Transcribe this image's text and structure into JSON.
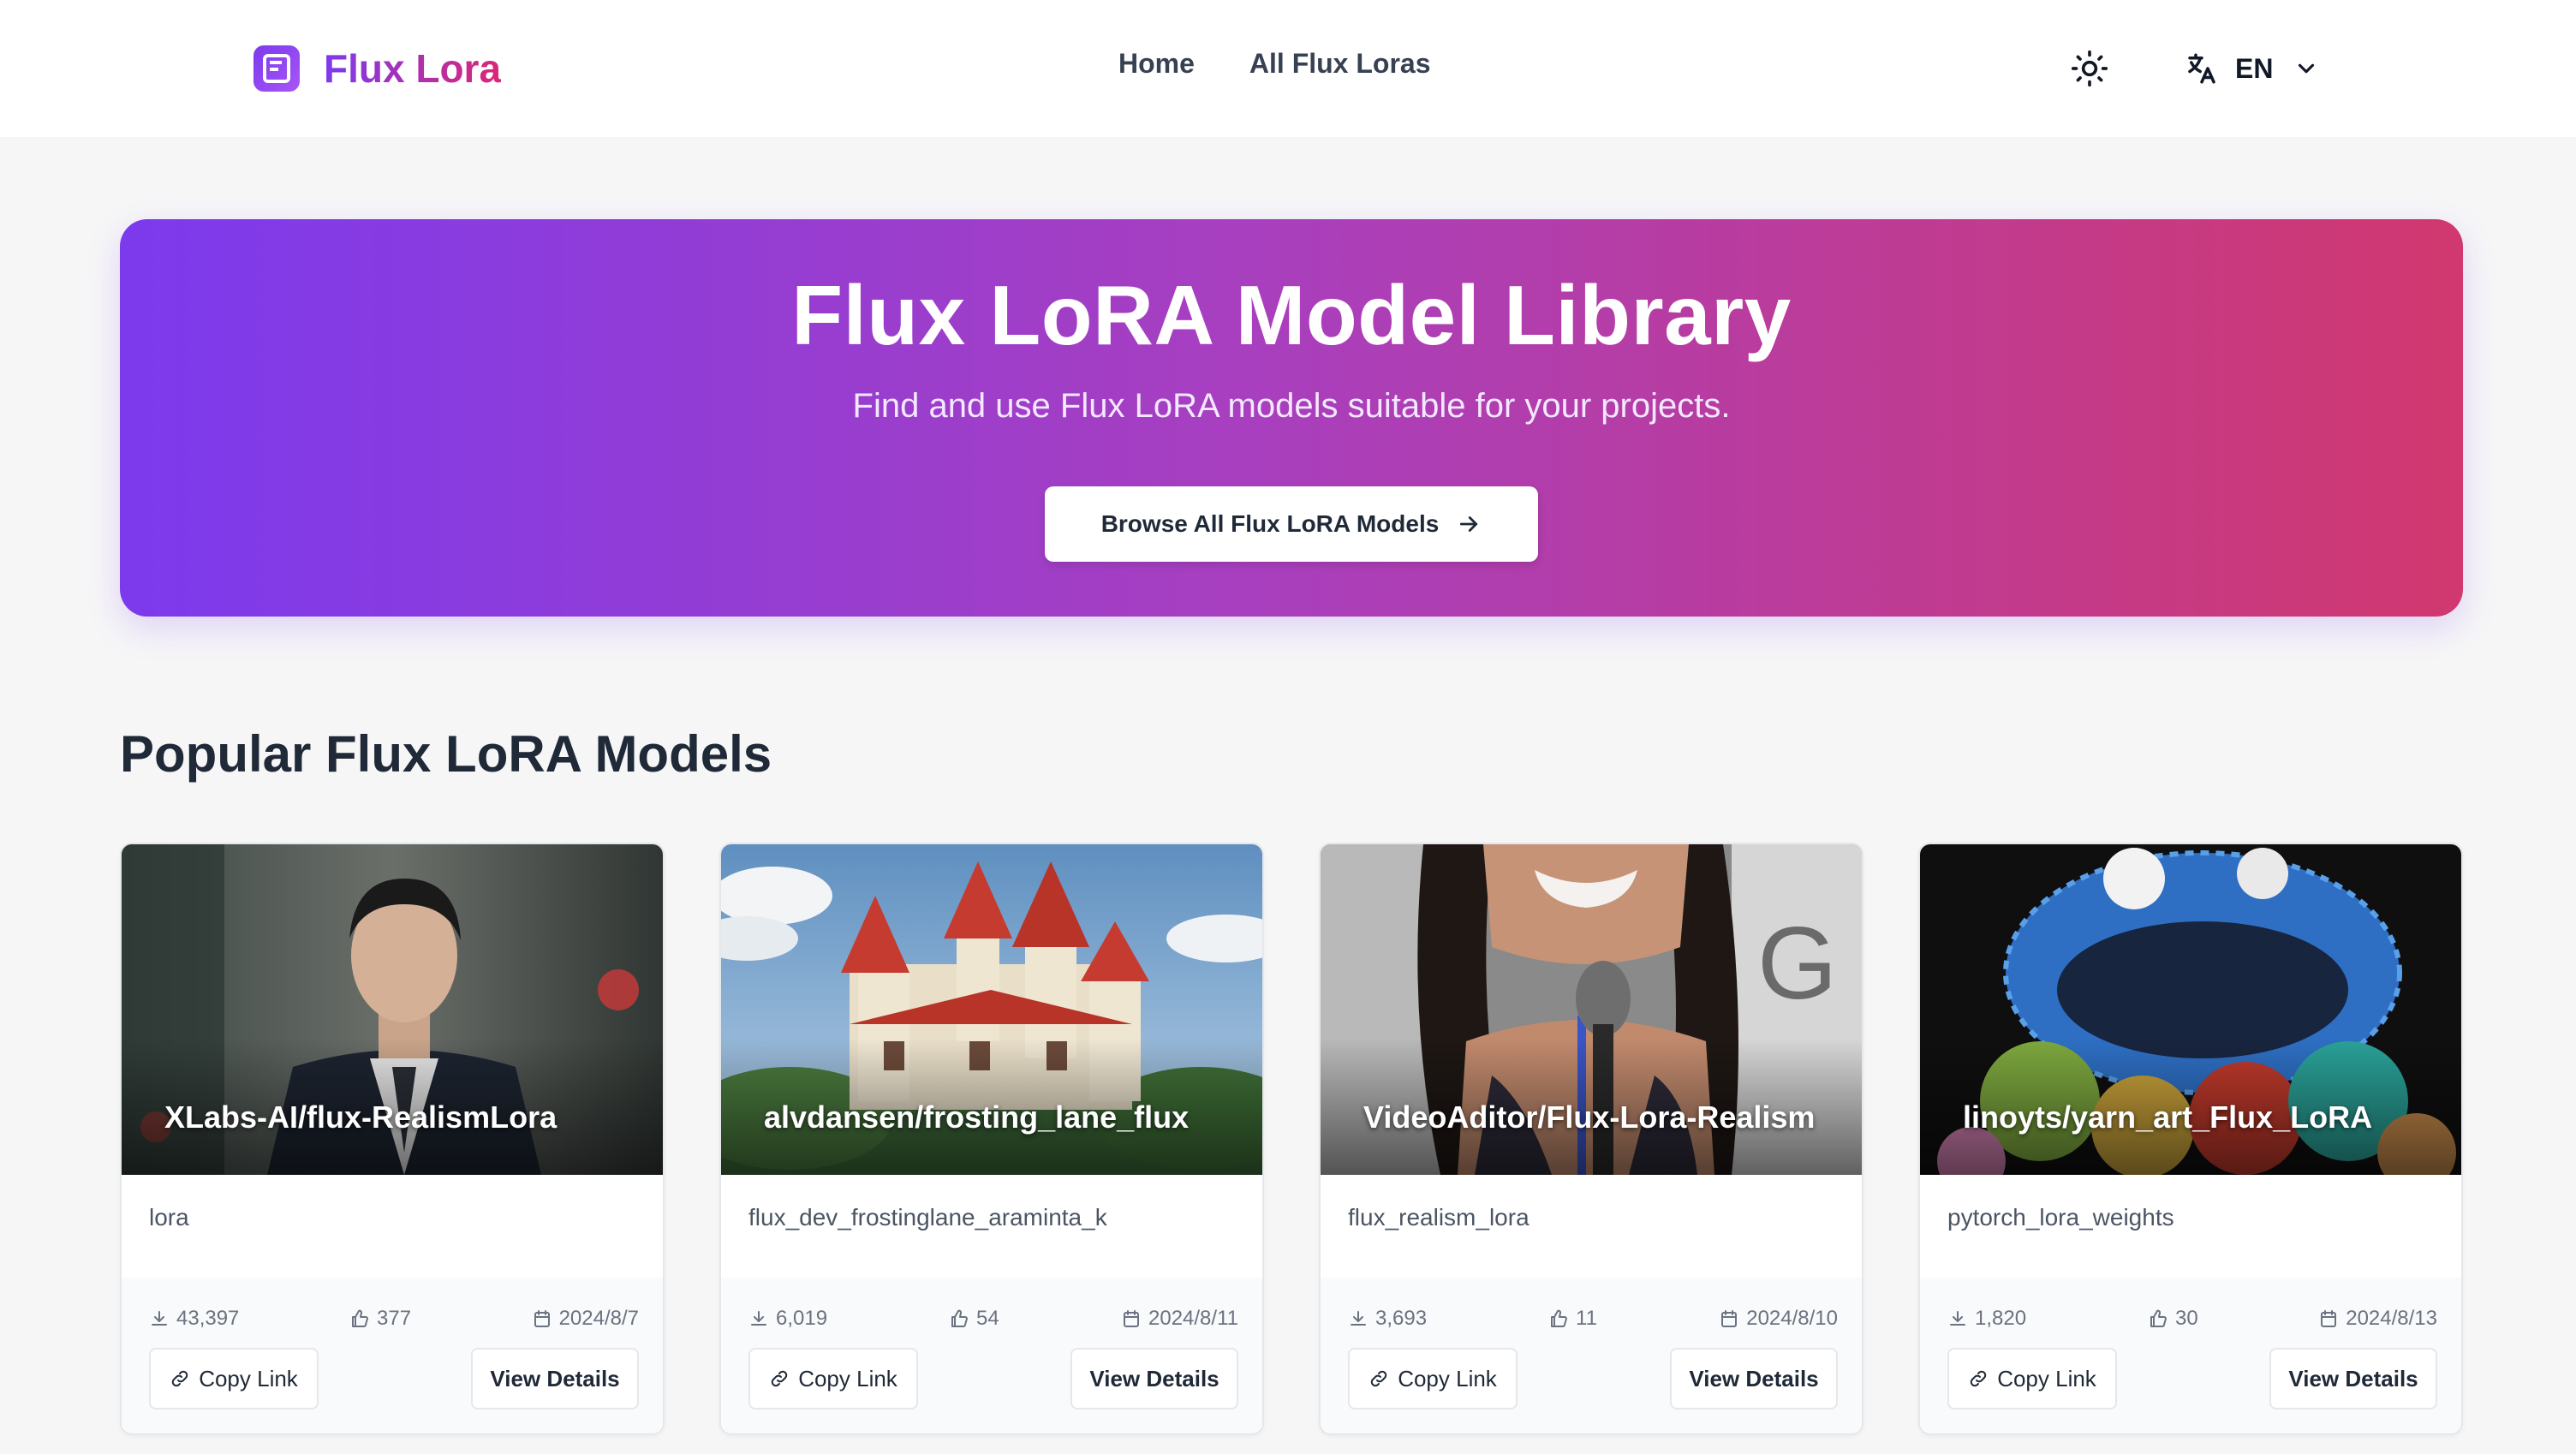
{
  "nav": {
    "brand_logo_icon": "flux-logo-icon",
    "brand_name": "Flux Lora",
    "links": [
      {
        "label": "Home"
      },
      {
        "label": "All Flux Loras"
      }
    ],
    "theme_icon": "sun-icon",
    "language": {
      "icon": "translate-icon",
      "selected": "EN",
      "chevron_icon": "chevron-down-icon"
    }
  },
  "hero": {
    "title": "Flux LoRA Model Library",
    "subtitle": "Find and use Flux LoRA models suitable for your projects.",
    "cta_label": "Browse All Flux LoRA Models",
    "cta_icon": "arrow-right-icon",
    "gradient": [
      "#7c3aed",
      "#d1386f"
    ]
  },
  "section": {
    "title": "Popular Flux LoRA Models"
  },
  "cards": [
    {
      "title": "XLabs-AI/flux-RealismLora",
      "description": "lora",
      "downloads": "43,397",
      "likes": "377",
      "date": "2024/8/7",
      "copy_label": "Copy Link",
      "view_label": "View Details"
    },
    {
      "title": "alvdansen/frosting_lane_flux",
      "description": "flux_dev_frostinglane_araminta_k",
      "downloads": "6,019",
      "likes": "54",
      "date": "2024/8/11",
      "copy_label": "Copy Link",
      "view_label": "View Details"
    },
    {
      "title": "VideoAditor/Flux-Lora-Realism",
      "description": "flux_realism_lora",
      "downloads": "3,693",
      "likes": "11",
      "date": "2024/8/10",
      "copy_label": "Copy Link",
      "view_label": "View Details"
    },
    {
      "title": "linoyts/yarn_art_Flux_LoRA",
      "description": "pytorch_lora_weights",
      "downloads": "1,820",
      "likes": "30",
      "date": "2024/8/13",
      "copy_label": "Copy Link",
      "view_label": "View Details"
    }
  ],
  "icons": {
    "download": "download-icon",
    "like": "thumbs-up-icon",
    "date": "calendar-icon",
    "link": "link-icon"
  }
}
